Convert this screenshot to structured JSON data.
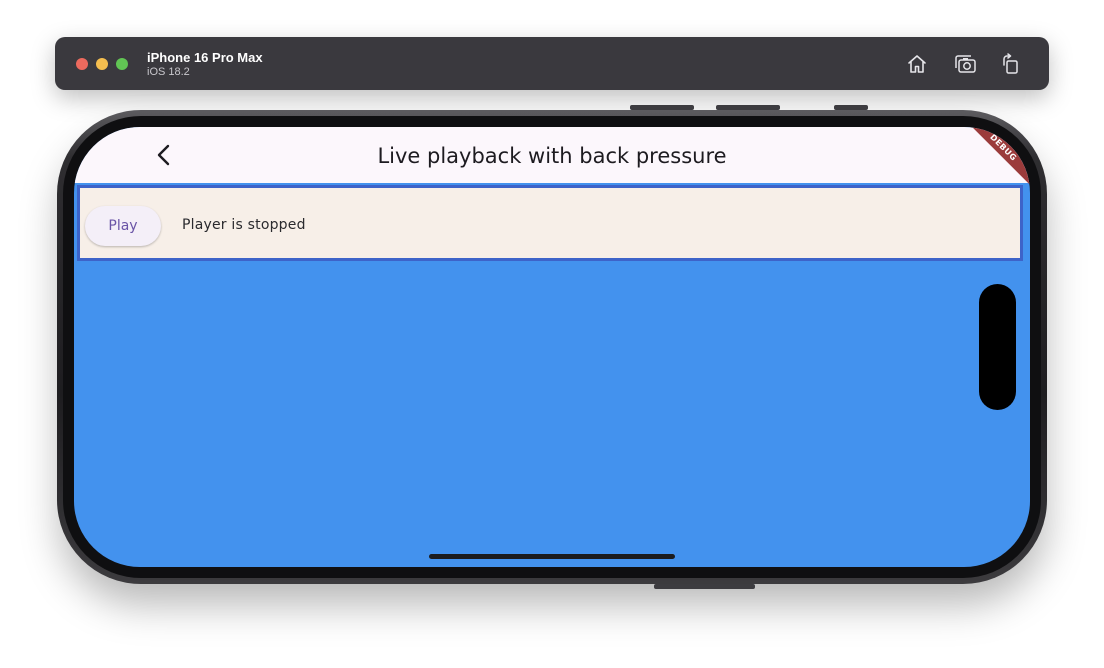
{
  "simulator": {
    "device_name": "iPhone 16 Pro Max",
    "os_version": "iOS 18.2",
    "icons": [
      "home-icon",
      "screenshot-icon",
      "rotate-icon"
    ]
  },
  "app_bar": {
    "title": "Live playback with back pressure",
    "back_icon": "chevron-left-icon",
    "debug_banner": "DEBUG"
  },
  "player": {
    "play_label": "Play",
    "status": "Player is stopped"
  },
  "colors": {
    "screen_background": "#4392ee",
    "panel_background": "#f7efe8",
    "panel_border": "#3d63c9",
    "app_bar_background": "#fcf7fc",
    "play_text": "#6a54a6",
    "debug_banner": "#9b3b3b"
  }
}
